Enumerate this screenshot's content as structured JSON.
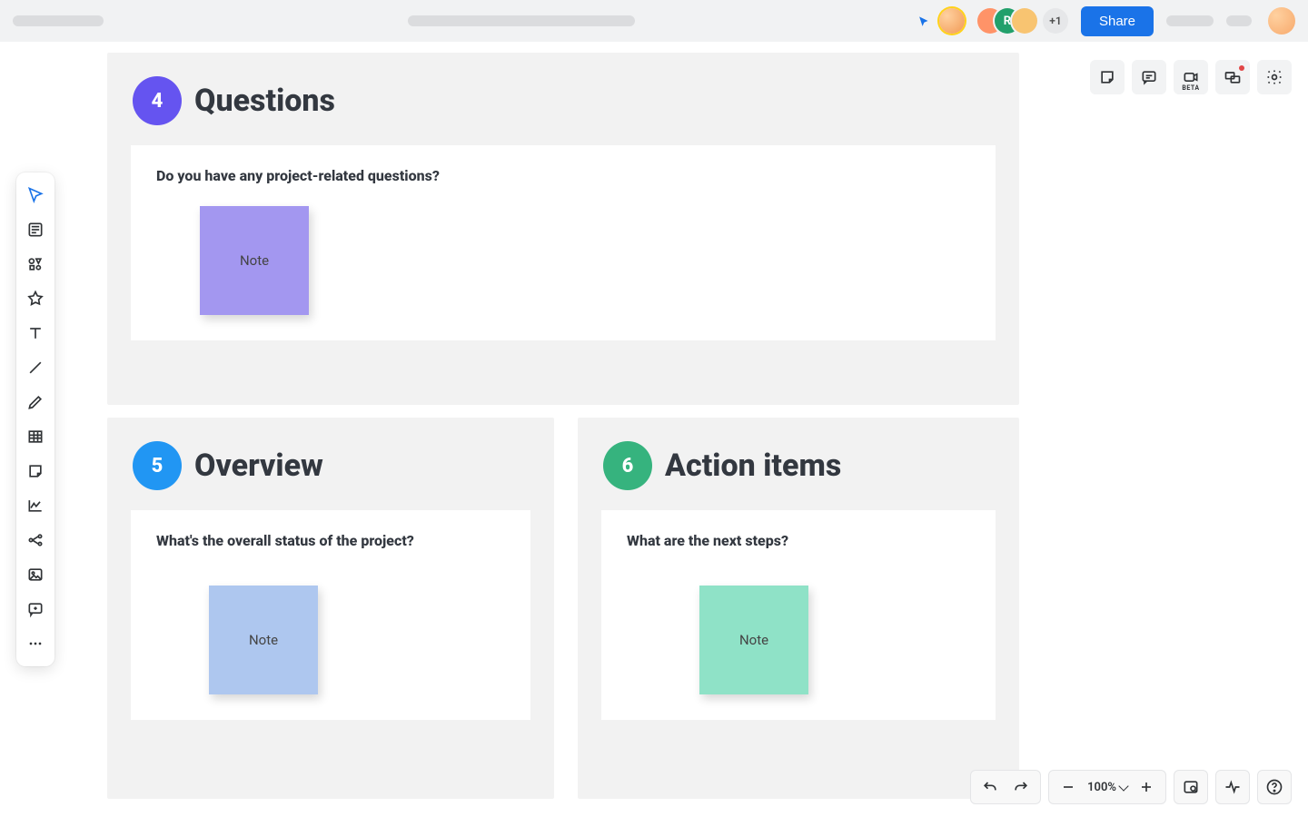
{
  "header": {
    "presence_letter": "R",
    "overflow_count": "+1",
    "share_label": "Share"
  },
  "frames": {
    "q": {
      "num": "4",
      "title": "Questions",
      "prompt": "Do you have any project-related questions?",
      "sticky": "Note"
    },
    "o": {
      "num": "5",
      "title": "Overview",
      "prompt": "What's the overall status of the project?",
      "sticky": "Note"
    },
    "a": {
      "num": "6",
      "title": "Action items",
      "prompt": "What are the next steps?",
      "sticky": "Note"
    }
  },
  "top_right_icons": {
    "beta_label": "BETA"
  },
  "zoom": {
    "label": "100%"
  }
}
